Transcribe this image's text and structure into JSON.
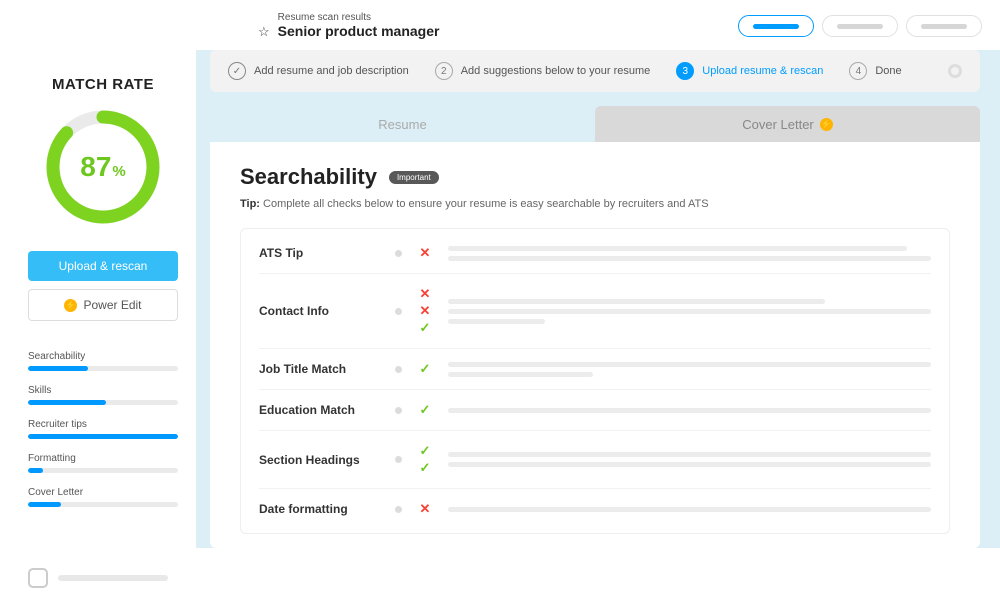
{
  "header": {
    "subtitle": "Resume scan results",
    "title": "Senior product manager"
  },
  "sidebar": {
    "match_heading": "MATCH RATE",
    "score": "87",
    "score_unit": "%",
    "upload_btn": "Upload & rescan",
    "power_btn": "Power Edit",
    "metrics": [
      {
        "label": "Searchability",
        "pct": 40
      },
      {
        "label": "Skills",
        "pct": 52
      },
      {
        "label": "Recruiter tips",
        "pct": 100
      },
      {
        "label": "Formatting",
        "pct": 10
      },
      {
        "label": "Cover Letter",
        "pct": 22
      }
    ]
  },
  "stepper": {
    "steps": [
      {
        "label": "Add resume and job description"
      },
      {
        "num": "2",
        "label": "Add suggestions below to your resume"
      },
      {
        "num": "3",
        "label": "Upload resume & rescan"
      },
      {
        "num": "4",
        "label": "Done"
      }
    ]
  },
  "tabs": {
    "resume": "Resume",
    "cover": "Cover Letter"
  },
  "panel": {
    "title": "Searchability",
    "badge": "Important",
    "tip_label": "Tip:",
    "tip_text": " Complete all checks below to ensure your resume is easy searchable by recruiters and ATS",
    "rows": [
      {
        "label": "ATS Tip",
        "statuses": [
          "x"
        ],
        "lines": [
          95,
          100
        ]
      },
      {
        "label": "Contact Info",
        "statuses": [
          "x",
          "x",
          "ck"
        ],
        "lines": [
          78,
          100,
          20
        ]
      },
      {
        "label": "Job Title Match",
        "statuses": [
          "ck"
        ],
        "lines": [
          100,
          30
        ]
      },
      {
        "label": "Education Match",
        "statuses": [
          "ck"
        ],
        "lines": [
          100
        ]
      },
      {
        "label": "Section Headings",
        "statuses": [
          "ck",
          "ck"
        ],
        "lines": [
          100,
          100
        ]
      },
      {
        "label": "Date formatting",
        "statuses": [
          "x"
        ],
        "lines": [
          100
        ]
      }
    ]
  }
}
